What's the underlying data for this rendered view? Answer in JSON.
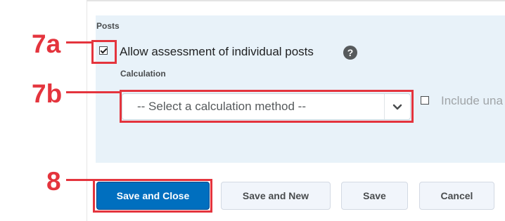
{
  "posts_section": {
    "title": "Posts",
    "allow_assessment_label": "Allow assessment of individual posts",
    "allow_assessment_checked": true,
    "help_icon": "question-circle-icon"
  },
  "calculation": {
    "label": "Calculation",
    "select_value": "-- Select a calculation method --",
    "include_label": "Include una"
  },
  "buttons": {
    "save_close": "Save and Close",
    "save_new": "Save and New",
    "save": "Save",
    "cancel": "Cancel"
  },
  "callouts": {
    "step_7a": "7a",
    "step_7b": "7b",
    "step_8": "8"
  },
  "colors": {
    "primary": "#006fbf",
    "callout_red": "#e4343d",
    "panel_bg": "#e8f2f9"
  }
}
